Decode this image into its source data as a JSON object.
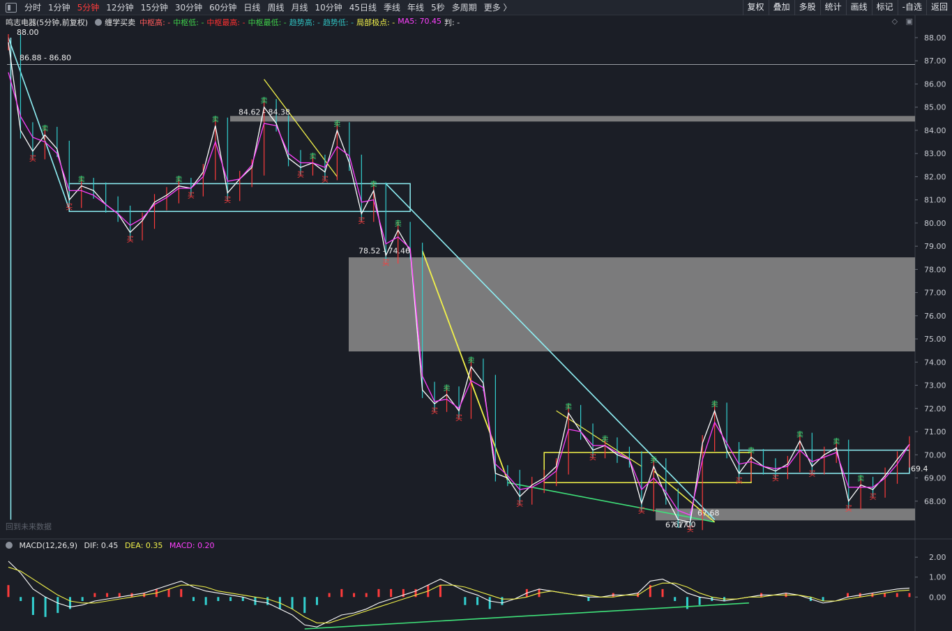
{
  "toolbar": {
    "periods": [
      "分时",
      "1分钟",
      "5分钟",
      "12分钟",
      "15分钟",
      "30分钟",
      "60分钟",
      "日线",
      "周线",
      "月线",
      "10分钟",
      "45日线",
      "季线",
      "年线",
      "5秒",
      "多周期",
      "更多 〉"
    ],
    "active_period": "5分钟",
    "right_buttons": [
      "复权",
      "叠加",
      "多股",
      "统计",
      "画线",
      "标记",
      "-自选",
      "返回"
    ]
  },
  "legend": {
    "stock_title": "鸣志电器(5分钟,前复权)",
    "indicator": "缠学买卖",
    "items": [
      {
        "text": "中枢高: -",
        "color": "#ff5a5a"
      },
      {
        "text": "中枢低: -",
        "color": "#3fd04a"
      },
      {
        "text": "中枢最高: -",
        "color": "#ff3030"
      },
      {
        "text": "中枢最低: -",
        "color": "#3fd04a"
      },
      {
        "text": "趋势高: -",
        "color": "#2fbfbf"
      },
      {
        "text": "趋势低: -",
        "color": "#2fbfbf"
      },
      {
        "text": "局部极点: -",
        "color": "#f3f34a"
      },
      {
        "text": "MA5: 70.45",
        "color": "#ff40ff"
      },
      {
        "text": "判: -",
        "color": "#e0e0e0"
      }
    ],
    "tool_icons": [
      "diamond-icon",
      "window-icon"
    ]
  },
  "footnote": "回到未来数据",
  "macd_legend": {
    "name": "MACD(12,26,9)",
    "dif": "DIF: 0.45",
    "dea": "DEA: 0.35",
    "macd": "MACD: 0.20"
  },
  "colors": {
    "up": "#ff3b3b",
    "down": "#33d0d0",
    "ma5": "#ff40ff",
    "price_line": "#ffffff",
    "yellow": "#f3f34a",
    "zone_gray": "#8c8c8c",
    "cyan_box": "#8ff0f5",
    "green": "#3fe27a"
  },
  "chart_data": [
    {
      "type": "line",
      "name": "price",
      "ylim": [
        67.0,
        88.3
      ],
      "yticks": [
        "88.00",
        "87.00",
        "86.00",
        "85.00",
        "84.00",
        "83.00",
        "82.00",
        "81.00",
        "80.00",
        "79.00",
        "78.00",
        "77.00",
        "76.00",
        "75.00",
        "74.00",
        "73.00",
        "72.00",
        "71.00",
        "70.00",
        "69.00",
        "68.00"
      ],
      "close": [
        87.8,
        84.0,
        83.1,
        83.8,
        83.2,
        81.0,
        81.6,
        81.4,
        80.8,
        80.4,
        79.6,
        80.1,
        80.9,
        81.2,
        81.6,
        81.5,
        82.2,
        84.2,
        81.3,
        81.9,
        82.4,
        85.0,
        84.3,
        82.8,
        82.4,
        82.6,
        82.2,
        84.0,
        82.6,
        80.4,
        81.4,
        78.6,
        79.7,
        78.8,
        72.8,
        72.2,
        72.6,
        71.9,
        73.8,
        73.1,
        69.2,
        69.0,
        68.2,
        68.7,
        69.0,
        69.5,
        71.8,
        71.0,
        70.2,
        70.4,
        70.0,
        69.8,
        67.9,
        69.5,
        68.2,
        67.2,
        67.1,
        70.5,
        71.9,
        70.2,
        69.2,
        69.9,
        69.5,
        69.3,
        69.6,
        70.6,
        69.5,
        70.0,
        70.3,
        68.0,
        68.7,
        68.5,
        69.1,
        69.8,
        70.45
      ],
      "ma5": [
        86.5,
        84.6,
        83.7,
        83.5,
        83.0,
        81.4,
        81.4,
        81.2,
        80.8,
        80.4,
        79.9,
        80.2,
        80.8,
        81.1,
        81.5,
        81.5,
        82.0,
        83.5,
        81.8,
        81.9,
        82.5,
        84.3,
        84.2,
        83.0,
        82.6,
        82.6,
        82.4,
        83.3,
        82.9,
        80.9,
        81.0,
        79.1,
        79.4,
        78.9,
        73.4,
        72.3,
        72.4,
        72.0,
        73.2,
        72.9,
        69.6,
        69.1,
        68.5,
        68.6,
        68.9,
        69.3,
        71.1,
        71.0,
        70.4,
        70.4,
        70.1,
        69.8,
        68.5,
        69.0,
        68.4,
        67.6,
        67.4,
        69.8,
        71.4,
        70.5,
        69.6,
        69.7,
        69.5,
        69.4,
        69.5,
        70.2,
        69.7,
        69.9,
        70.1,
        68.6,
        68.6,
        68.6,
        69.0,
        69.6,
        70.45
      ],
      "annotations": [
        {
          "label": "88.00",
          "value": 88.0
        },
        {
          "label": "86.88 - 86.80",
          "value": 86.84
        },
        {
          "label": "84.62 - 84.38",
          "value": 84.5
        },
        {
          "label": "78.52 - 74.46",
          "value": 78.5
        },
        {
          "label": "67.00",
          "value": 67.0
        },
        {
          "label": "67.17",
          "value": 67.17
        },
        {
          "label": "67.68",
          "value": 67.68
        },
        {
          "label": "69.4",
          "value": 69.4
        }
      ],
      "zones": [
        {
          "name": "zone-84",
          "y1": 84.62,
          "y2": 84.38
        },
        {
          "name": "zone-78",
          "y1": 78.52,
          "y2": 74.46
        },
        {
          "name": "zone-67",
          "y1": 67.68,
          "y2": 67.17
        }
      ],
      "hline": 86.84,
      "sell_marker": "卖",
      "buy_marker": "买"
    },
    {
      "type": "bar",
      "name": "MACD(12,26,9)",
      "ylim": [
        -1.6,
        2.6
      ],
      "yticks": [
        "2.00",
        "1.00",
        "0.00"
      ],
      "dif": [
        1.8,
        1.2,
        0.4,
        0.0,
        -0.3,
        -0.5,
        -0.4,
        -0.2,
        -0.1,
        0.0,
        0.1,
        0.2,
        0.4,
        0.6,
        0.8,
        0.5,
        0.3,
        0.2,
        0.1,
        0.0,
        -0.2,
        -0.3,
        -0.6,
        -0.9,
        -1.4,
        -1.5,
        -1.2,
        -0.9,
        -0.8,
        -0.6,
        -0.3,
        -0.1,
        0.1,
        0.3,
        0.6,
        0.9,
        0.6,
        0.3,
        0.1,
        -0.2,
        -0.3,
        -0.1,
        0.2,
        0.4,
        0.3,
        0.2,
        0.1,
        0.0,
        0.0,
        0.1,
        0.1,
        0.2,
        0.8,
        0.9,
        0.6,
        0.2,
        0.0,
        -0.1,
        -0.2,
        -0.1,
        0.0,
        0.1,
        0.1,
        0.2,
        0.1,
        -0.1,
        -0.3,
        -0.2,
        0.0,
        0.1,
        0.2,
        0.3,
        0.4,
        0.45
      ],
      "dea": [
        1.5,
        1.3,
        0.9,
        0.5,
        0.1,
        -0.2,
        -0.3,
        -0.3,
        -0.2,
        -0.1,
        0.0,
        0.1,
        0.2,
        0.4,
        0.6,
        0.6,
        0.5,
        0.3,
        0.2,
        0.1,
        0.0,
        -0.1,
        -0.3,
        -0.6,
        -1.0,
        -1.3,
        -1.3,
        -1.1,
        -0.9,
        -0.7,
        -0.5,
        -0.3,
        -0.1,
        0.1,
        0.3,
        0.6,
        0.6,
        0.5,
        0.3,
        0.1,
        -0.1,
        -0.1,
        0.0,
        0.2,
        0.3,
        0.2,
        0.1,
        0.1,
        0.0,
        0.0,
        0.1,
        0.1,
        0.5,
        0.7,
        0.7,
        0.5,
        0.2,
        0.0,
        -0.1,
        -0.1,
        0.0,
        0.0,
        0.1,
        0.1,
        0.1,
        0.0,
        -0.2,
        -0.2,
        -0.1,
        0.0,
        0.1,
        0.2,
        0.3,
        0.35
      ],
      "macd": [
        0.6,
        -0.2,
        -0.9,
        -1.0,
        -0.8,
        -0.6,
        -0.2,
        0.2,
        0.2,
        0.2,
        0.2,
        0.2,
        0.4,
        0.4,
        0.4,
        -0.2,
        -0.4,
        -0.2,
        -0.2,
        -0.2,
        -0.4,
        -0.4,
        -0.6,
        -0.6,
        -0.8,
        -0.4,
        0.2,
        0.4,
        0.2,
        0.2,
        0.4,
        0.4,
        0.4,
        0.4,
        0.6,
        0.6,
        0.0,
        -0.4,
        -0.4,
        -0.6,
        -0.4,
        0.0,
        0.4,
        0.4,
        0.0,
        0.0,
        0.0,
        -0.2,
        0.0,
        0.2,
        0.0,
        0.2,
        0.6,
        0.4,
        -0.2,
        -0.6,
        -0.4,
        -0.2,
        -0.2,
        0.0,
        0.0,
        0.2,
        0.0,
        0.2,
        0.0,
        -0.2,
        -0.2,
        0.0,
        0.2,
        0.2,
        0.2,
        0.2,
        0.2,
        0.2
      ]
    }
  ]
}
